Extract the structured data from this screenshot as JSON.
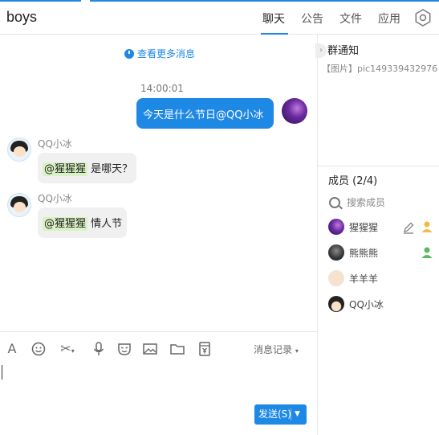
{
  "header": {
    "title": "boys",
    "tabs": [
      "聊天",
      "公告",
      "文件",
      "应用"
    ],
    "active_tab": "聊天"
  },
  "chat": {
    "more_messages": "查看更多消息",
    "messages": [
      {
        "timestamp": "14:00:01",
        "text": "今天是什么节日@QQ小冰"
      },
      {
        "sender": "QQ小冰",
        "mention": "@猩猩猩",
        "text": "是哪天？"
      },
      {
        "sender": "QQ小冰",
        "mention": "@猩猩猩",
        "text": "情人节"
      }
    ]
  },
  "toolbar": {
    "history_label": "消息记录",
    "icons": [
      "font-icon",
      "emoji-icon",
      "scissors-icon",
      "microphone-icon",
      "mask-icon",
      "image-icon",
      "folder-icon",
      "red-packet-icon"
    ]
  },
  "send": {
    "label": "发送(S)"
  },
  "sidebar": {
    "notice_title": "群通知",
    "notice_text": "【图片】pic149339432976...",
    "members_title": "成员 (2/4)",
    "search_placeholder": "搜索成员",
    "members": [
      {
        "name": "猩猩猩"
      },
      {
        "name": "熊熊熊"
      },
      {
        "name": "羊羊羊"
      },
      {
        "name": "QQ小冰"
      }
    ]
  },
  "colors": {
    "accent": "#1e88e5",
    "mention_bg": "#d9f2c4"
  }
}
